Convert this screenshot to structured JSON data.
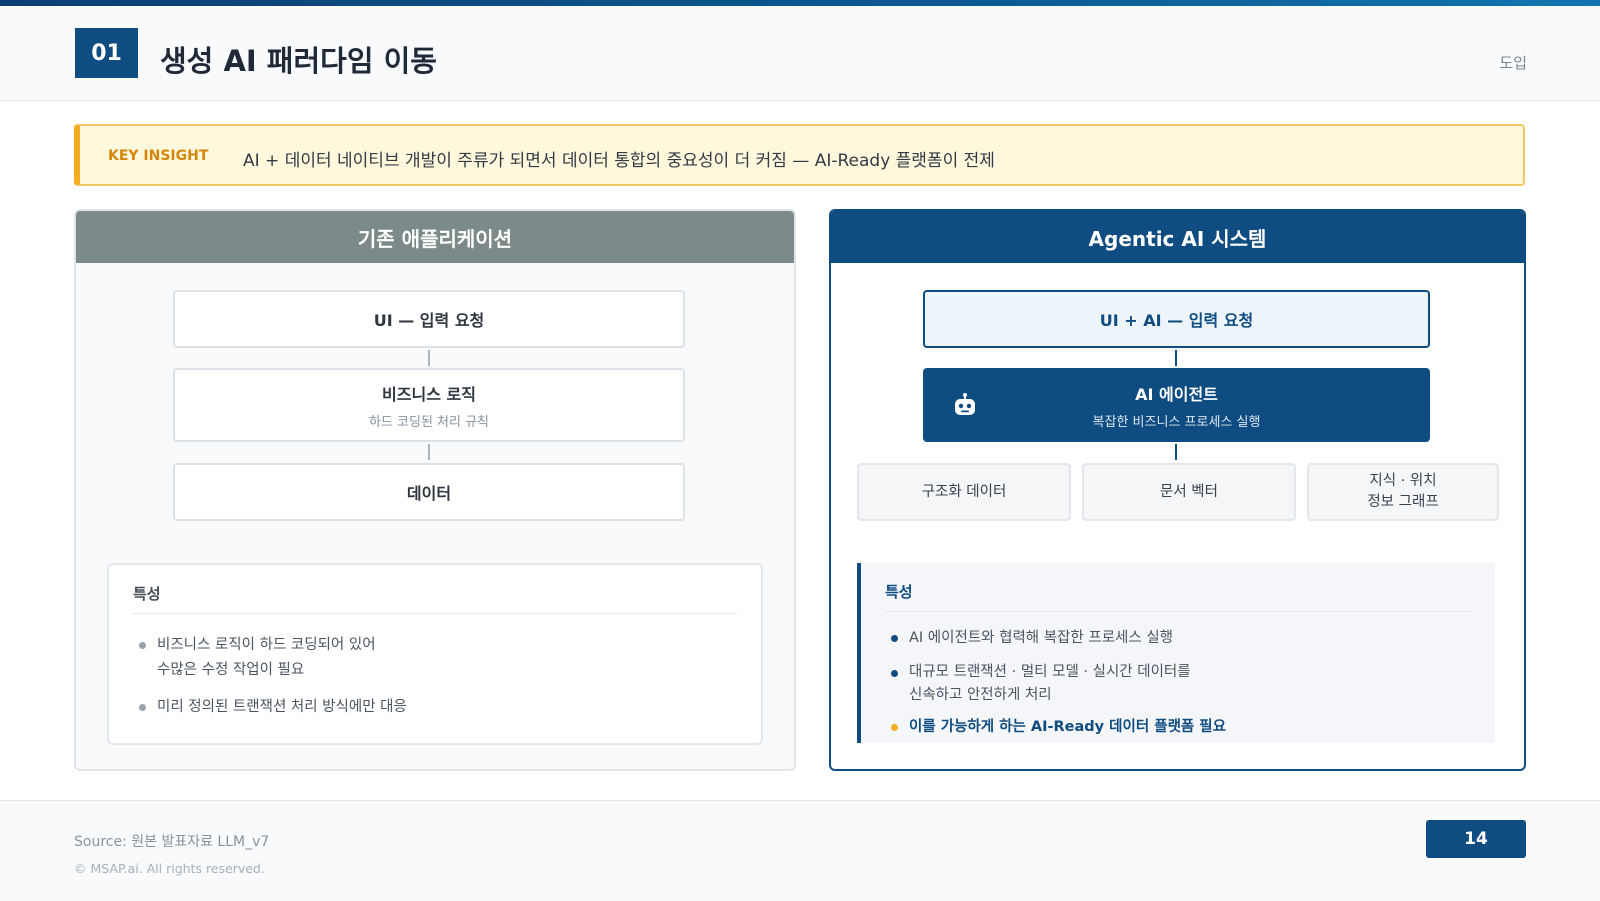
{
  "header": {
    "section_number": "01",
    "title": "생성 AI 패러다임 이동",
    "section_tag": "도입"
  },
  "insight": {
    "label": "KEY INSIGHT",
    "text": "AI + 데이터 네이티브 개발이 주류가 되면서 데이터 통합의 중요성이 더 커짐 — AI-Ready 플랫폼이 전제"
  },
  "left_panel": {
    "title": "기존 애플리케이션",
    "flow": [
      {
        "label": "UI — 입력 요청",
        "sub": ""
      },
      {
        "label": "비즈니스 로직",
        "sub": "하드 코딩된 처리 규칙"
      },
      {
        "label": "데이터",
        "sub": ""
      }
    ],
    "features": {
      "title": "특성",
      "items": [
        {
          "line1": "비즈니스 로직이 하드 코딩되어 있어",
          "line2": "수많은 수정 작업이 필요"
        },
        {
          "line1": "미리 정의된 트랜잭션 처리 방식에만 대응",
          "line2": ""
        }
      ]
    }
  },
  "right_panel": {
    "title": "Agentic AI 시스템",
    "input_box": "UI + AI — 입력 요청",
    "agent": {
      "label": "AI 에이전트",
      "sub": "복잡한 비즈니스 프로세스 실행",
      "icon": "robot-icon"
    },
    "data_sources": [
      {
        "line1": "구조화 데이터",
        "line2": ""
      },
      {
        "line1": "문서 벡터",
        "line2": ""
      },
      {
        "line1": "지식 · 위치",
        "line2": "정보 그래프"
      }
    ],
    "features": {
      "title": "특성",
      "items": [
        {
          "line1": "AI 에이전트와 협력해 복잡한 프로세스 실행",
          "line2": ""
        },
        {
          "line1": "대규모 트랜잭션 · 멀티 모델 · 실시간 데이터를",
          "line2": "신속하고 안전하게 처리"
        },
        {
          "line1": "이를 가능하게 하는 AI-Ready 데이터 플랫폼 필요",
          "line2": ""
        }
      ]
    }
  },
  "footer": {
    "source": "Source: 원본 발표자료 LLM_v7",
    "copyright": "© MSAP.ai. All rights reserved.",
    "page_number": "14"
  },
  "colors": {
    "primary": "#0f4c81",
    "accent": "#f4ad21",
    "legacy_header": "#7c8a89",
    "insight_bg": "#fff8dd"
  }
}
